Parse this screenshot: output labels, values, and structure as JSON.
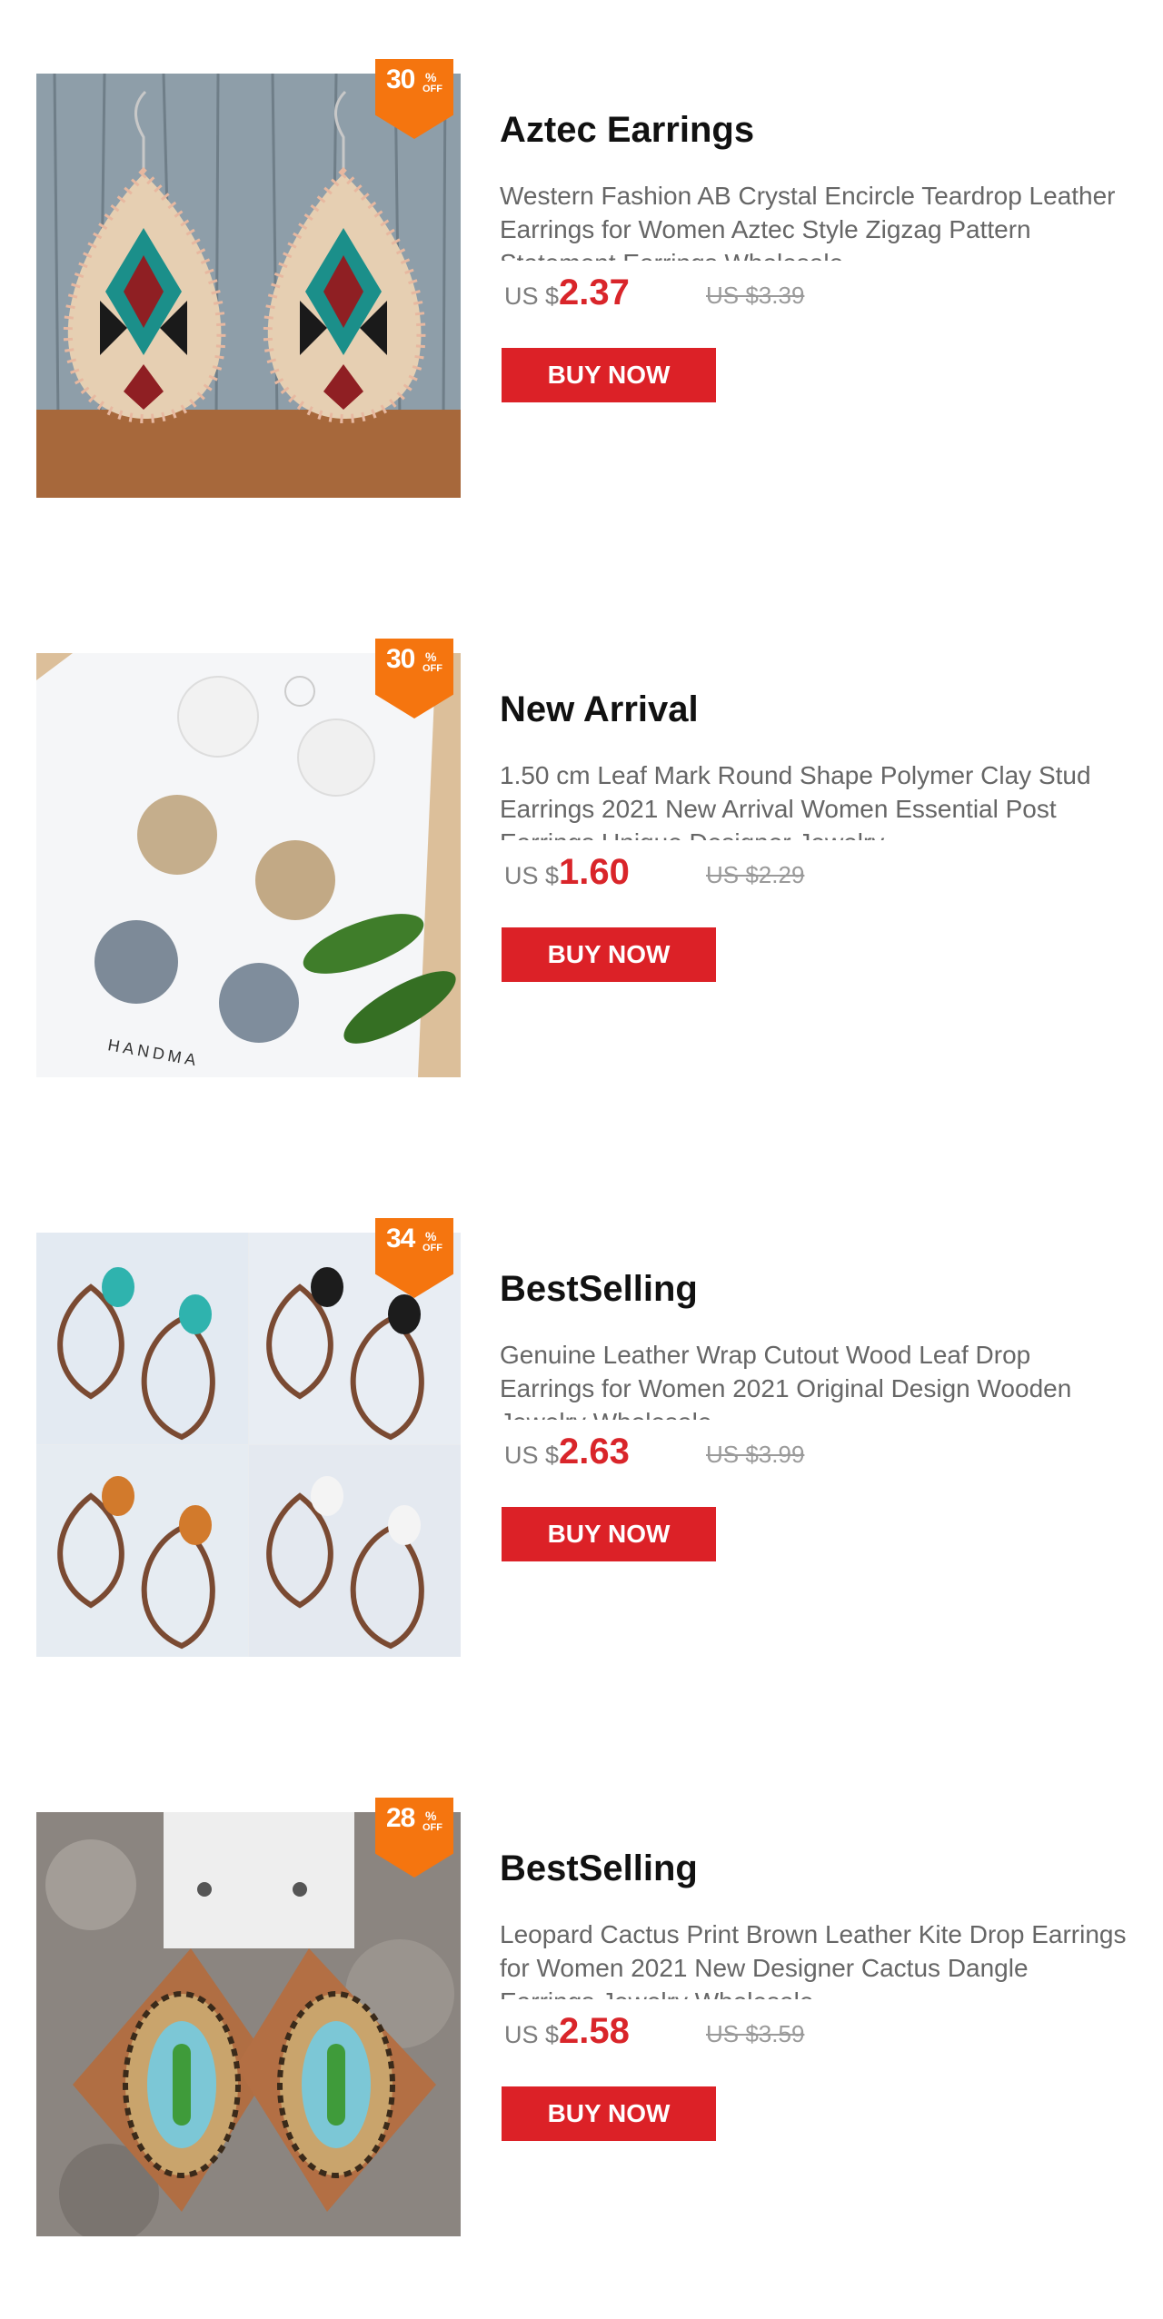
{
  "products": [
    {
      "badge": {
        "percent": "30",
        "pct_sign": "%",
        "off": "OFF"
      },
      "title": "Aztec Earrings",
      "description": "Western Fashion AB Crystal Encircle Teardrop Leather Earrings for Women Aztec Style Zigzag Pattern Statement Earrings Wholesale",
      "price_currency": "US $",
      "price_value": "2.37",
      "old_price": "US $3.39",
      "buy_label": "BUY NOW"
    },
    {
      "badge": {
        "percent": "30",
        "pct_sign": "%",
        "off": "OFF"
      },
      "title": "New Arrival",
      "description": "1.50 cm Leaf Mark Round Shape Polymer Clay Stud Earrings 2021 New Arrival Women Essential Post Earrings Unique Designer Jewelry",
      "price_currency": "US $",
      "price_value": "1.60",
      "old_price": "US $2.29",
      "buy_label": "BUY NOW",
      "photo_text": "HANDMA"
    },
    {
      "badge": {
        "percent": "34",
        "pct_sign": "%",
        "off": "OFF"
      },
      "title": "BestSelling",
      "description": "Genuine Leather Wrap Cutout Wood Leaf Drop Earrings for Women 2021 Original Design Wooden Jewelry Wholesale",
      "price_currency": "US $",
      "price_value": "2.63",
      "old_price": "US $3.99",
      "buy_label": "BUY NOW"
    },
    {
      "badge": {
        "percent": "28",
        "pct_sign": "%",
        "off": "OFF"
      },
      "title": "BestSelling",
      "description": "Leopard Cactus Print Brown Leather Kite Drop Earrings for Women 2021 New Designer Cactus Dangle Earrings Jewelry Wholesale",
      "price_currency": "US $",
      "price_value": "2.58",
      "old_price": "US $3.59",
      "buy_label": "BUY NOW"
    }
  ],
  "colors": {
    "badge": "#f5750f",
    "price": "#d9252a",
    "button": "#dc2127"
  }
}
